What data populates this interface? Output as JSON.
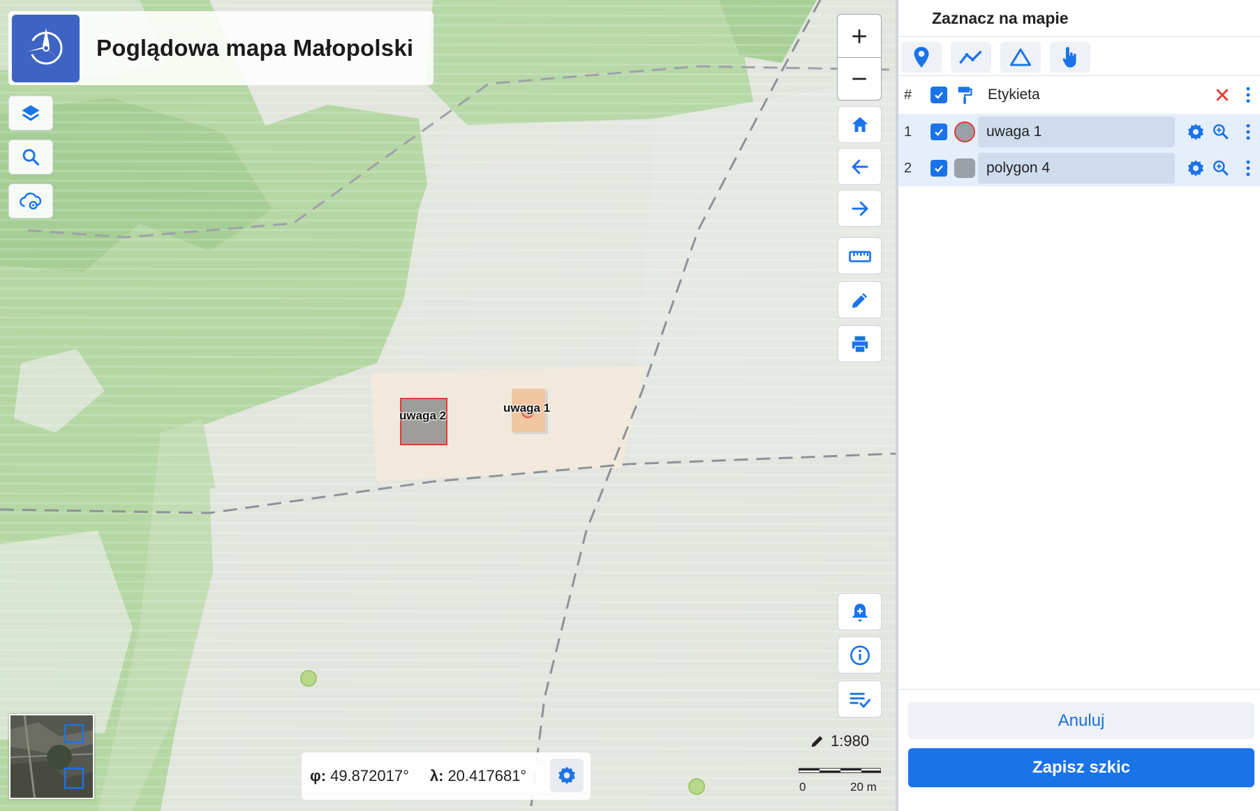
{
  "app": {
    "title": "Poglądowa mapa Małopolski"
  },
  "map": {
    "markers": [
      {
        "label": "uwaga 2"
      },
      {
        "label": "uwaga 1"
      }
    ],
    "coordinates": {
      "phi_label": "φ:",
      "phi_value": "49.872017°",
      "lambda_label": "λ:",
      "lambda_value": "20.417681°"
    },
    "scale": {
      "ratio": "1:980",
      "bar_start": "0",
      "bar_end": "20 m"
    },
    "left_controls": [
      "layers-icon",
      "search-icon",
      "cloud-settings-icon"
    ],
    "right_controls": [
      "zoom-in-icon",
      "zoom-out-icon",
      "home-icon",
      "arrow-left-icon",
      "arrow-right-icon",
      "ruler-icon",
      "pencil-icon",
      "printer-icon",
      "bell-plus-icon",
      "info-icon",
      "checklist-icon"
    ]
  },
  "panel": {
    "title": "Zaznacz na mapie",
    "tools": [
      "pin-icon",
      "polyline-icon",
      "triangle-icon",
      "pointer-hand-icon"
    ],
    "table": {
      "header": {
        "number": "#",
        "label": "Etykieta"
      },
      "rows": [
        {
          "number": "1",
          "name": "uwaga 1"
        },
        {
          "number": "2",
          "name": "polygon 4"
        }
      ]
    },
    "cancel_label": "Anuluj",
    "save_label": "Zapisz szkic"
  },
  "colors": {
    "accent": "#1a73e8",
    "logo": "#3d64c4",
    "delete": "#e53935",
    "forest": "#a9cf98",
    "field": "#e3e7df"
  }
}
